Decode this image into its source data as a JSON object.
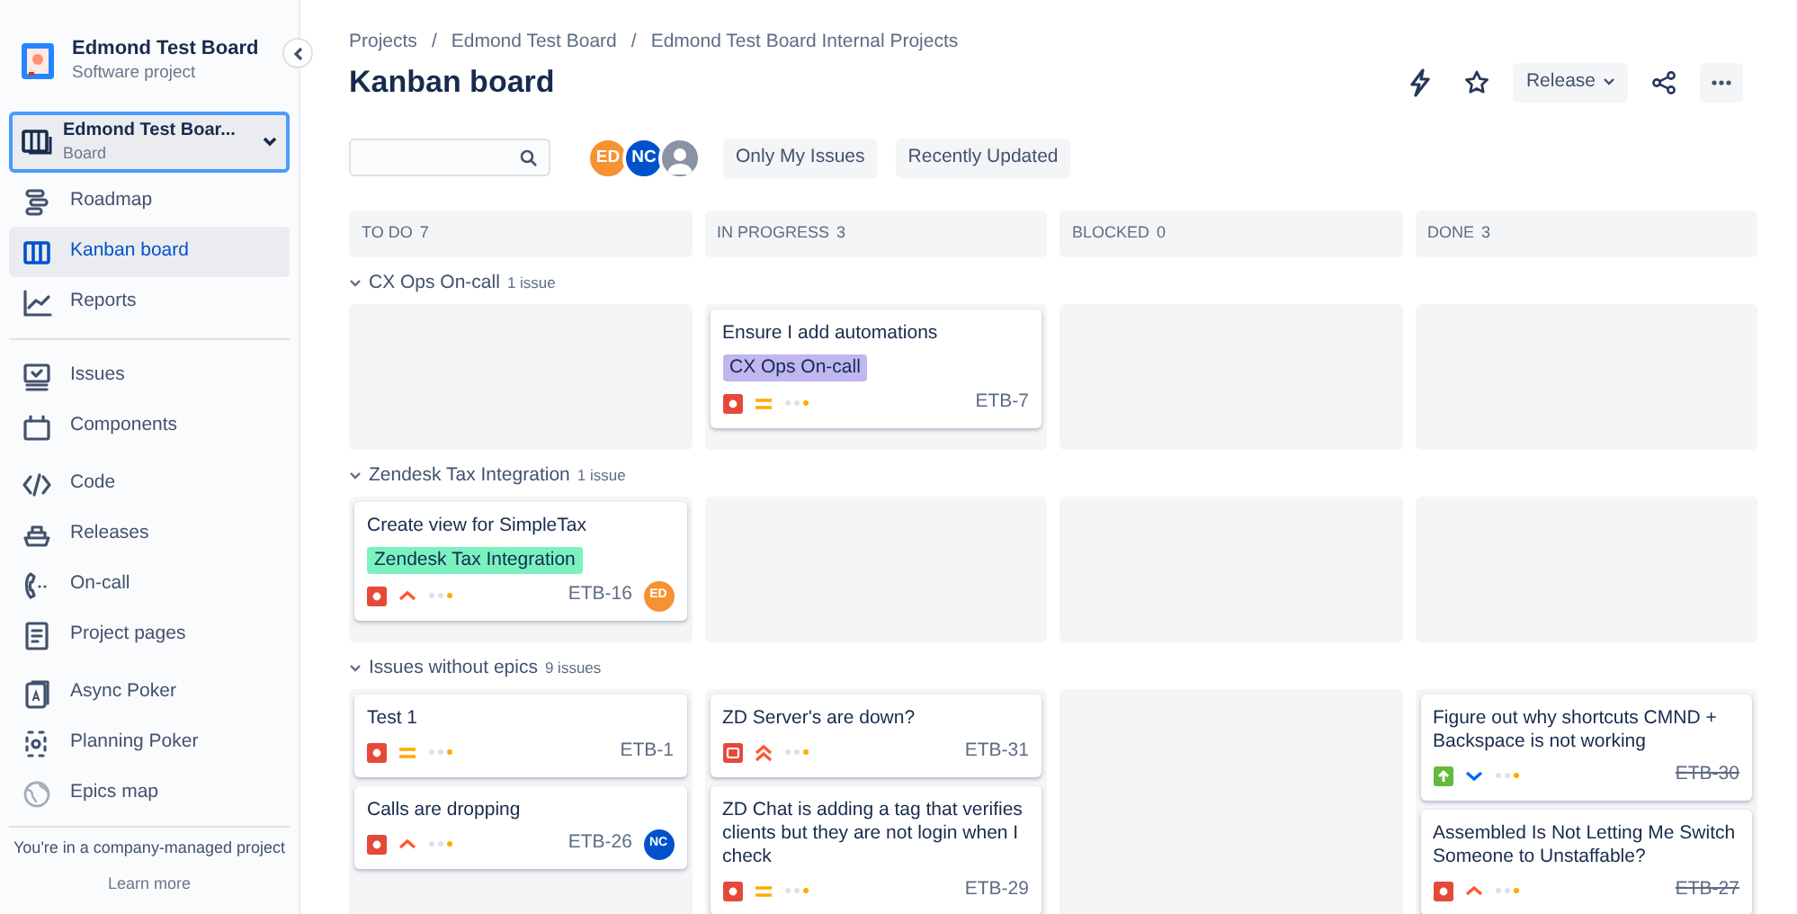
{
  "sidebar": {
    "project": {
      "name": "Edmond Test Board",
      "type": "Software project"
    },
    "board_selector": {
      "name": "Edmond Test Boar...",
      "type": "Board"
    },
    "groups": [
      [
        {
          "label": "Roadmap",
          "selected": false
        },
        {
          "label": "Kanban board",
          "selected": true
        },
        {
          "label": "Reports",
          "selected": false
        }
      ],
      [
        {
          "label": "Issues",
          "selected": false
        },
        {
          "label": "Components",
          "selected": false
        },
        {
          "label": "Code",
          "selected": false
        },
        {
          "label": "Releases",
          "selected": false
        },
        {
          "label": "On-call",
          "selected": false
        },
        {
          "label": "Project pages",
          "selected": false
        },
        {
          "label": "Async Poker",
          "selected": false
        },
        {
          "label": "Planning Poker",
          "selected": false
        },
        {
          "label": "Epics map",
          "selected": false
        }
      ]
    ],
    "footer": "You're in a company-managed project",
    "footer_link": "Learn more"
  },
  "breadcrumbs": [
    "Projects",
    "Edmond Test Board",
    "Edmond Test Board Internal Projects"
  ],
  "breadcrumb_separators": [
    "/",
    "/"
  ],
  "title": "Kanban board",
  "release_button": "Release",
  "avatars": [
    {
      "initials": "ED",
      "color": "#f79232"
    },
    {
      "initials": "NC",
      "color": "#0052cc"
    },
    {
      "color": "#8993a4"
    }
  ],
  "filters": [
    "Only My Issues",
    "Recently Updated"
  ],
  "columns": [
    {
      "name": "TO DO",
      "count": "7"
    },
    {
      "name": "IN PROGRESS",
      "count": "3"
    },
    {
      "name": "BLOCKED",
      "count": "0"
    },
    {
      "name": "DONE",
      "count": "3"
    }
  ],
  "swimlanes": [
    {
      "title": "CX Ops On-call",
      "count": "1 issue",
      "expanded": true,
      "cells": [
        [],
        [
          {
            "summary": "Ensure I add automations",
            "epic": {
              "text": "CX Ops On-call",
              "color": "#c0b6f2"
            },
            "kind": "bug",
            "priority": {
              "kind": "medium"
            },
            "key": "ETB-7",
            "done": false
          }
        ],
        [],
        []
      ]
    },
    {
      "title": "Zendesk Tax Integration",
      "count": "1 issue",
      "expanded": true,
      "cells": [
        [
          {
            "summary": "Create view for SimpleTax",
            "epic": {
              "text": "Zendesk Tax Integration",
              "color": "#79f2c0"
            },
            "kind": "bug",
            "priority": {
              "kind": "high"
            },
            "key": "ETB-16",
            "done": false,
            "assignee": {
              "initials": "ED",
              "color": "#f79232"
            }
          }
        ],
        [],
        [],
        []
      ]
    },
    {
      "title": "Issues without epics",
      "count": "9 issues",
      "expanded": true,
      "cells": [
        [
          {
            "summary": "Test 1",
            "kind": "bug",
            "priority": {
              "kind": "medium"
            },
            "key": "ETB-1",
            "done": false
          },
          {
            "summary": "Calls are dropping",
            "kind": "bug",
            "priority": {
              "kind": "high"
            },
            "key": "ETB-26",
            "done": false,
            "assignee": {
              "initials": "NC",
              "color": "#0052cc"
            }
          }
        ],
        [
          {
            "summary": "ZD Server's are down?",
            "kind": "incident",
            "priority": {
              "kind": "highest"
            },
            "key": "ETB-31",
            "done": false
          },
          {
            "summary": "ZD Chat is adding a tag that verifies clients but they are not login when I check",
            "kind": "bug",
            "priority": {
              "kind": "medium"
            },
            "key": "ETB-29",
            "done": false
          }
        ],
        [],
        [
          {
            "summary": "Figure out why shortcuts CMND + Backspace is not working",
            "kind": "story",
            "priority": {
              "kind": "low"
            },
            "key": "ETB-30",
            "done": true
          },
          {
            "summary": "Assembled Is Not Letting Me Switch Someone to Unstaffable?",
            "kind": "bug",
            "priority": {
              "kind": "high"
            },
            "key": "ETB-27",
            "done": true
          }
        ]
      ]
    }
  ]
}
